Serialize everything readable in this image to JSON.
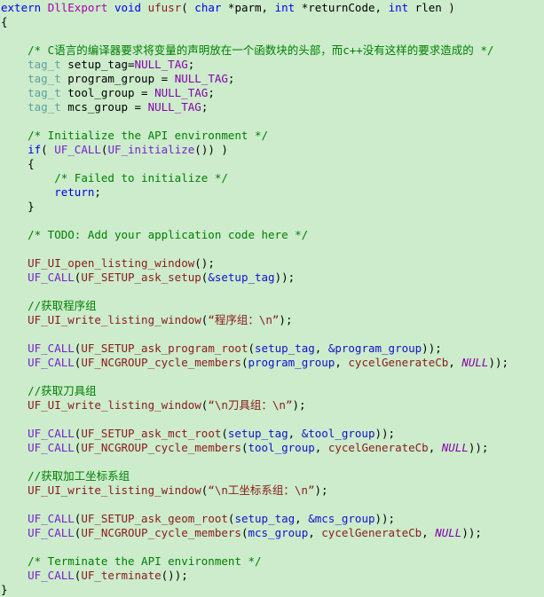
{
  "editor": {
    "name": "source-code-view",
    "background_color": "#cceccc",
    "language": "C",
    "colors": {
      "keyword": "#0000ee",
      "macro": "#aa00aa",
      "function": "#8b1a1a",
      "call_macro": "#7722cc",
      "type": "#5f9ea0",
      "constant": "#8800aa",
      "variable": "#1111cc",
      "string": "#8b1a1a",
      "comment": "#008000",
      "plain": "#000000"
    }
  },
  "lines": [
    {
      "indent": 0,
      "tokens": [
        {
          "c": "t-keyword",
          "t": "extern"
        },
        {
          "c": "t-plain",
          "t": " "
        },
        {
          "c": "t-macro",
          "t": "DllExport"
        },
        {
          "c": "t-plain",
          "t": " "
        },
        {
          "c": "t-keyword",
          "t": "void"
        },
        {
          "c": "t-plain",
          "t": " "
        },
        {
          "c": "t-func",
          "t": "ufusr"
        },
        {
          "c": "t-plain",
          "t": "( "
        },
        {
          "c": "t-keyword",
          "t": "char"
        },
        {
          "c": "t-plain",
          "t": " *parm, "
        },
        {
          "c": "t-keyword",
          "t": "int"
        },
        {
          "c": "t-plain",
          "t": " *returnCode, "
        },
        {
          "c": "t-keyword",
          "t": "int"
        },
        {
          "c": "t-plain",
          "t": " rlen )"
        }
      ]
    },
    {
      "indent": 0,
      "tokens": [
        {
          "c": "t-plain",
          "t": "{"
        }
      ]
    },
    {
      "indent": 0,
      "tokens": []
    },
    {
      "indent": 4,
      "tokens": [
        {
          "c": "t-comment",
          "t": "/* C语言的编译器要求将变量的声明放在一个函数块的头部，而c++没有这样的要求造成的 */"
        }
      ]
    },
    {
      "indent": 4,
      "tokens": [
        {
          "c": "t-type",
          "t": "tag_t"
        },
        {
          "c": "t-plain",
          "t": " setup_tag="
        },
        {
          "c": "t-const",
          "t": "NULL_TAG"
        },
        {
          "c": "t-plain",
          "t": ";"
        }
      ]
    },
    {
      "indent": 4,
      "tokens": [
        {
          "c": "t-type",
          "t": "tag_t"
        },
        {
          "c": "t-plain",
          "t": " program_group = "
        },
        {
          "c": "t-const",
          "t": "NULL_TAG"
        },
        {
          "c": "t-plain",
          "t": ";"
        }
      ]
    },
    {
      "indent": 4,
      "tokens": [
        {
          "c": "t-type",
          "t": "tag_t"
        },
        {
          "c": "t-plain",
          "t": " tool_group = "
        },
        {
          "c": "t-const",
          "t": "NULL_TAG"
        },
        {
          "c": "t-plain",
          "t": ";"
        }
      ]
    },
    {
      "indent": 4,
      "tokens": [
        {
          "c": "t-type",
          "t": "tag_t"
        },
        {
          "c": "t-plain",
          "t": " mcs_group = "
        },
        {
          "c": "t-const",
          "t": "NULL_TAG"
        },
        {
          "c": "t-plain",
          "t": ";"
        }
      ]
    },
    {
      "indent": 0,
      "tokens": []
    },
    {
      "indent": 4,
      "tokens": [
        {
          "c": "t-comment",
          "t": "/* Initialize the API environment */"
        }
      ]
    },
    {
      "indent": 4,
      "tokens": [
        {
          "c": "t-keyword",
          "t": "if"
        },
        {
          "c": "t-plain",
          "t": "( "
        },
        {
          "c": "t-call",
          "t": "UF_CALL"
        },
        {
          "c": "t-plain",
          "t": "("
        },
        {
          "c": "t-call",
          "t": "UF_initialize"
        },
        {
          "c": "t-plain",
          "t": "()) )"
        }
      ]
    },
    {
      "indent": 4,
      "tokens": [
        {
          "c": "t-plain",
          "t": "{"
        }
      ]
    },
    {
      "indent": 8,
      "tokens": [
        {
          "c": "t-comment",
          "t": "/* Failed to initialize */"
        }
      ]
    },
    {
      "indent": 8,
      "tokens": [
        {
          "c": "t-keyword",
          "t": "return"
        },
        {
          "c": "t-plain",
          "t": ";"
        }
      ]
    },
    {
      "indent": 4,
      "tokens": [
        {
          "c": "t-plain",
          "t": "}"
        }
      ]
    },
    {
      "indent": 0,
      "tokens": []
    },
    {
      "indent": 4,
      "tokens": [
        {
          "c": "t-comment",
          "t": "/* TODO: Add your application code here */"
        }
      ]
    },
    {
      "indent": 0,
      "tokens": []
    },
    {
      "indent": 4,
      "tokens": [
        {
          "c": "t-func",
          "t": "UF_UI_open_listing_window"
        },
        {
          "c": "t-plain",
          "t": "();"
        }
      ]
    },
    {
      "indent": 4,
      "tokens": [
        {
          "c": "t-call",
          "t": "UF_CALL"
        },
        {
          "c": "t-plain",
          "t": "("
        },
        {
          "c": "t-func",
          "t": "UF_SETUP_ask_setup"
        },
        {
          "c": "t-plain",
          "t": "("
        },
        {
          "c": "t-var",
          "t": "&setup_tag"
        },
        {
          "c": "t-plain",
          "t": "));"
        }
      ]
    },
    {
      "indent": 0,
      "tokens": []
    },
    {
      "indent": 4,
      "tokens": [
        {
          "c": "t-comment",
          "t": "//获取程序组"
        }
      ]
    },
    {
      "indent": 4,
      "tokens": [
        {
          "c": "t-func",
          "t": "UF_UI_write_listing_window"
        },
        {
          "c": "t-plain",
          "t": "("
        },
        {
          "c": "t-str",
          "t": "“程序组：\\n”"
        },
        {
          "c": "t-plain",
          "t": ");"
        }
      ]
    },
    {
      "indent": 0,
      "tokens": []
    },
    {
      "indent": 4,
      "tokens": [
        {
          "c": "t-call",
          "t": "UF_CALL"
        },
        {
          "c": "t-plain",
          "t": "("
        },
        {
          "c": "t-func",
          "t": "UF_SETUP_ask_program_root"
        },
        {
          "c": "t-plain",
          "t": "("
        },
        {
          "c": "t-var",
          "t": "setup_tag"
        },
        {
          "c": "t-plain",
          "t": ", "
        },
        {
          "c": "t-var",
          "t": "&program_group"
        },
        {
          "c": "t-plain",
          "t": "));"
        }
      ]
    },
    {
      "indent": 4,
      "tokens": [
        {
          "c": "t-call",
          "t": "UF_CALL"
        },
        {
          "c": "t-plain",
          "t": "("
        },
        {
          "c": "t-func",
          "t": "UF_NCGROUP_cycle_members"
        },
        {
          "c": "t-plain",
          "t": "("
        },
        {
          "c": "t-var",
          "t": "program_group"
        },
        {
          "c": "t-plain",
          "t": ", "
        },
        {
          "c": "t-func",
          "t": "cycelGenerateCb"
        },
        {
          "c": "t-plain",
          "t": ", "
        },
        {
          "c": "t-constit",
          "t": "NULL"
        },
        {
          "c": "t-plain",
          "t": "));"
        }
      ]
    },
    {
      "indent": 0,
      "tokens": []
    },
    {
      "indent": 4,
      "tokens": [
        {
          "c": "t-comment",
          "t": "//获取刀具组"
        }
      ]
    },
    {
      "indent": 4,
      "tokens": [
        {
          "c": "t-func",
          "t": "UF_UI_write_listing_window"
        },
        {
          "c": "t-plain",
          "t": "("
        },
        {
          "c": "t-str",
          "t": "“\\n刀具组：\\n”"
        },
        {
          "c": "t-plain",
          "t": ");"
        }
      ]
    },
    {
      "indent": 0,
      "tokens": []
    },
    {
      "indent": 4,
      "tokens": [
        {
          "c": "t-call",
          "t": "UF_CALL"
        },
        {
          "c": "t-plain",
          "t": "("
        },
        {
          "c": "t-func",
          "t": "UF_SETUP_ask_mct_root"
        },
        {
          "c": "t-plain",
          "t": "("
        },
        {
          "c": "t-var",
          "t": "setup_tag"
        },
        {
          "c": "t-plain",
          "t": ", "
        },
        {
          "c": "t-var",
          "t": "&tool_group"
        },
        {
          "c": "t-plain",
          "t": "));"
        }
      ]
    },
    {
      "indent": 4,
      "tokens": [
        {
          "c": "t-call",
          "t": "UF_CALL"
        },
        {
          "c": "t-plain",
          "t": "("
        },
        {
          "c": "t-func",
          "t": "UF_NCGROUP_cycle_members"
        },
        {
          "c": "t-plain",
          "t": "("
        },
        {
          "c": "t-var",
          "t": "tool_group"
        },
        {
          "c": "t-plain",
          "t": ", "
        },
        {
          "c": "t-func",
          "t": "cycelGenerateCb"
        },
        {
          "c": "t-plain",
          "t": ", "
        },
        {
          "c": "t-constit",
          "t": "NULL"
        },
        {
          "c": "t-plain",
          "t": "));"
        }
      ]
    },
    {
      "indent": 0,
      "tokens": []
    },
    {
      "indent": 4,
      "tokens": [
        {
          "c": "t-comment",
          "t": "//获取加工坐标系组"
        }
      ]
    },
    {
      "indent": 4,
      "tokens": [
        {
          "c": "t-func",
          "t": "UF_UI_write_listing_window"
        },
        {
          "c": "t-plain",
          "t": "("
        },
        {
          "c": "t-str",
          "t": "“\\n工坐标系组：\\n”"
        },
        {
          "c": "t-plain",
          "t": ");"
        }
      ]
    },
    {
      "indent": 0,
      "tokens": []
    },
    {
      "indent": 4,
      "tokens": [
        {
          "c": "t-call",
          "t": "UF_CALL"
        },
        {
          "c": "t-plain",
          "t": "("
        },
        {
          "c": "t-func",
          "t": "UF_SETUP_ask_geom_root"
        },
        {
          "c": "t-plain",
          "t": "("
        },
        {
          "c": "t-var",
          "t": "setup_tag"
        },
        {
          "c": "t-plain",
          "t": ", "
        },
        {
          "c": "t-var",
          "t": "&mcs_group"
        },
        {
          "c": "t-plain",
          "t": "));"
        }
      ]
    },
    {
      "indent": 4,
      "tokens": [
        {
          "c": "t-call",
          "t": "UF_CALL"
        },
        {
          "c": "t-plain",
          "t": "("
        },
        {
          "c": "t-func",
          "t": "UF_NCGROUP_cycle_members"
        },
        {
          "c": "t-plain",
          "t": "("
        },
        {
          "c": "t-var",
          "t": "mcs_group"
        },
        {
          "c": "t-plain",
          "t": ", "
        },
        {
          "c": "t-func",
          "t": "cycelGenerateCb"
        },
        {
          "c": "t-plain",
          "t": ", "
        },
        {
          "c": "t-constit",
          "t": "NULL"
        },
        {
          "c": "t-plain",
          "t": "));"
        }
      ]
    },
    {
      "indent": 0,
      "tokens": []
    },
    {
      "indent": 4,
      "tokens": [
        {
          "c": "t-comment",
          "t": "/* Terminate the API environment */"
        }
      ]
    },
    {
      "indent": 4,
      "tokens": [
        {
          "c": "t-call",
          "t": "UF_CALL"
        },
        {
          "c": "t-plain",
          "t": "("
        },
        {
          "c": "t-func",
          "t": "UF_terminate"
        },
        {
          "c": "t-plain",
          "t": "());"
        }
      ]
    },
    {
      "indent": 0,
      "tokens": [
        {
          "c": "t-plain",
          "t": "}"
        }
      ]
    }
  ]
}
